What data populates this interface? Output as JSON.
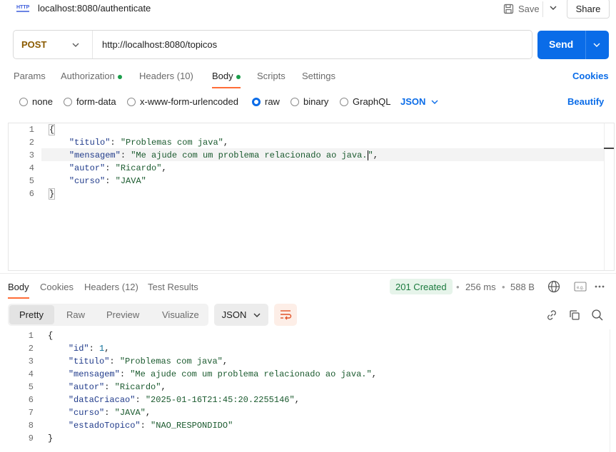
{
  "header": {
    "title": "localhost:8080/authenticate",
    "save_label": "Save",
    "share_label": "Share",
    "icons": [
      "http-icon",
      "save-icon",
      "chevron-down-icon"
    ]
  },
  "request": {
    "method": "POST",
    "url": "http://localhost:8080/topicos",
    "send_label": "Send",
    "tabs": [
      {
        "label": "Params"
      },
      {
        "label": "Authorization"
      },
      {
        "label": "Headers (10)"
      },
      {
        "label": "Body"
      },
      {
        "label": "Scripts"
      },
      {
        "label": "Settings"
      }
    ],
    "active_tab": "Body",
    "cookies_label": "Cookies",
    "body_types": [
      {
        "label": "none"
      },
      {
        "label": "form-data"
      },
      {
        "label": "x-www-form-urlencoded"
      },
      {
        "label": "raw"
      },
      {
        "label": "binary"
      },
      {
        "label": "GraphQL"
      }
    ],
    "selected_body_type": "raw",
    "language": "JSON",
    "beautify_label": "Beautify",
    "line_numbers": [
      "1",
      "2",
      "3",
      "4",
      "5",
      "6"
    ]
  },
  "response": {
    "tabs": [
      {
        "label": "Body"
      },
      {
        "label": "Cookies"
      },
      {
        "label": "Headers (12)"
      },
      {
        "label": "Test Results"
      }
    ],
    "status": "201 Created",
    "time": "256 ms",
    "size": "588 B",
    "views": [
      {
        "label": "Pretty"
      },
      {
        "label": "Raw"
      },
      {
        "label": "Preview"
      },
      {
        "label": "Visualize"
      }
    ],
    "active_view": "Pretty",
    "format": "JSON",
    "line_numbers": [
      "1",
      "2",
      "3",
      "4",
      "5",
      "6",
      "7",
      "8",
      "9"
    ]
  },
  "colors": {
    "accent": "#0a6ce8",
    "method": "#8a5a00",
    "status_ok": "#1b7a3e",
    "tab_indicator": "#ff6c37"
  }
}
